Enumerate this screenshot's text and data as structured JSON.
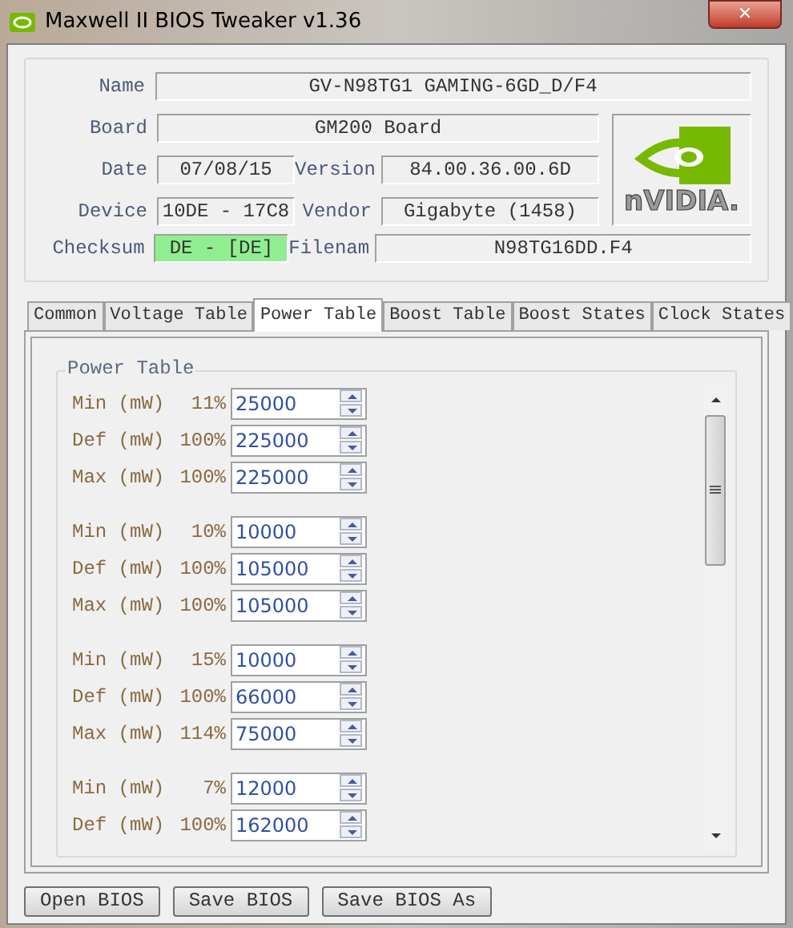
{
  "window": {
    "title": "Maxwell II BIOS Tweaker v1.36",
    "close": "✕"
  },
  "info": {
    "fields": [
      {
        "label": "Name",
        "value": "GV-N98TG1 GAMING-6GD_D/F4"
      },
      {
        "label": "Board",
        "value": "GM200 Board"
      },
      {
        "label": "Date",
        "value": "07/08/15"
      },
      {
        "label": "Version",
        "value": "84.00.36.00.6D"
      },
      {
        "label": "Device",
        "value": "10DE - 17C8"
      },
      {
        "label": "Vendor",
        "value": "Gigabyte (1458)"
      },
      {
        "label": "Checksum",
        "value": "DE - [DE]",
        "valid": true
      },
      {
        "label": "Filenam",
        "value": "N98TG16DD.F4"
      }
    ],
    "logo_text": "nVIDIA."
  },
  "tabs": [
    {
      "label": "Common",
      "selected": false
    },
    {
      "label": "Voltage Table",
      "selected": false
    },
    {
      "label": "Power Table",
      "selected": true
    },
    {
      "label": "Boost Table",
      "selected": false
    },
    {
      "label": "Boost States",
      "selected": false
    },
    {
      "label": "Clock States",
      "selected": false
    }
  ],
  "power_table": {
    "title": "Power Table",
    "groups": [
      {
        "rows": [
          {
            "label": "Min (mW)",
            "percent": "11%",
            "value": "25000"
          },
          {
            "label": "Def (mW)",
            "percent": "100%",
            "value": "225000"
          },
          {
            "label": "Max (mW)",
            "percent": "100%",
            "value": "225000"
          }
        ]
      },
      {
        "rows": [
          {
            "label": "Min (mW)",
            "percent": "10%",
            "value": "10000"
          },
          {
            "label": "Def (mW)",
            "percent": "100%",
            "value": "105000"
          },
          {
            "label": "Max (mW)",
            "percent": "100%",
            "value": "105000"
          }
        ]
      },
      {
        "rows": [
          {
            "label": "Min (mW)",
            "percent": "15%",
            "value": "10000"
          },
          {
            "label": "Def (mW)",
            "percent": "100%",
            "value": "66000"
          },
          {
            "label": "Max (mW)",
            "percent": "114%",
            "value": "75000"
          }
        ]
      },
      {
        "rows": [
          {
            "label": "Min (mW)",
            "percent": "7%",
            "value": "12000"
          },
          {
            "label": "Def (mW)",
            "percent": "100%",
            "value": "162000"
          }
        ]
      }
    ]
  },
  "buttons": [
    "Open BIOS",
    "Save BIOS",
    "Save BIOS As"
  ]
}
